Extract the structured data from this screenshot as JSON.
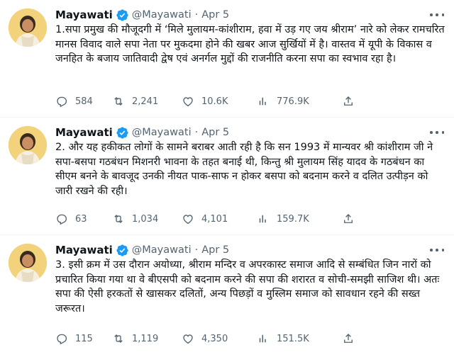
{
  "tweets": [
    {
      "name": "Mayawati",
      "handle": "@Mayawati",
      "separator": "·",
      "date": "Apr 5",
      "text": "1.सपा प्रमुख की मौजूदगी में ‘मिले मुलायम-कांशीराम, हवा में उड़ गए जय श्रीराम’ नारे को लेकर रामचरित मानस विवाद वाले सपा नेता पर मुकदमा होने की खबर आज सुर्खियों में है। वास्तव में यूपी के विकास व जनहित के बजाय जातिवादी द्वेष एवं अनर्गल मुद्दों की राजनीति करना सपा का स्वभाव रहा है।",
      "replies": "584",
      "retweets": "2,241",
      "likes": "10.6K",
      "views": "776.9K"
    },
    {
      "name": "Mayawati",
      "handle": "@Mayawati",
      "separator": "·",
      "date": "Apr 5",
      "text": "2. और यह हकीकत लोगों के सामने बराबर आती रही है कि सन 1993 में मान्यवर श्री कांशीराम जी ने सपा-बसपा गठबंधन मिशनरी भावना के तहत बनाई थी, किन्तु श्री मुलायम सिंह यादव के गठबंधन का सीएम बनने के बावजूद उनकी नीयत पाक-साफ न होकर बसपा को बदनाम करने व दलित उत्पीड़न को जारी रखने की रही।",
      "replies": "63",
      "retweets": "1,034",
      "likes": "4,101",
      "views": "159.7K"
    },
    {
      "name": "Mayawati",
      "handle": "@Mayawati",
      "separator": "·",
      "date": "Apr 5",
      "text": "3. इसी क्रम में उस दौरान अयोध्या, श्रीराम मन्दिर व अपरकास्ट समाज आदि से सम्बंधित जिन नारों को  प्रचारित किया गया था वे बीएसपी को बदनाम करने की सपा की शरारत व सोची-समझी साजिश थी। अतः सपा की ऐसी हरकतों से खासकर दलितों, अन्य पिछड़ों व मुस्लिम समाज को सावधान रहने की सख्त जरूरत।",
      "replies": "115",
      "retweets": "1,119",
      "likes": "4,350",
      "views": "151.5K"
    }
  ],
  "icons": {
    "verified": "verified-badge-icon",
    "more": "more-options-icon",
    "reply": "reply-icon",
    "retweet": "retweet-icon",
    "like": "like-icon",
    "views": "views-icon",
    "share": "share-icon"
  },
  "colors": {
    "verified": "#1d9bf0",
    "muted": "#536471",
    "text": "#0f1419",
    "divider": "#eff3f4"
  }
}
